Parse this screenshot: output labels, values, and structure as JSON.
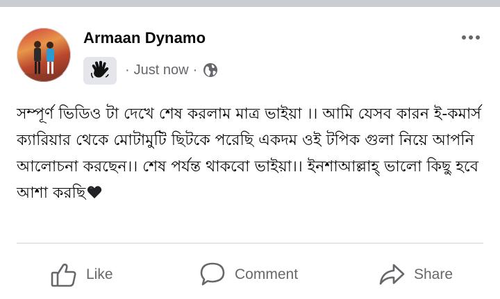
{
  "post": {
    "author_name": "Armaan Dynamo",
    "timestamp": "Just now",
    "separator": "·",
    "privacy_icon": "globe-icon",
    "badge_icon": "waving-hand-icon",
    "text": "সম্পূর্ণ ভিডিও টা দেখে শেষ করলাম মাত্র ভাইয়া ।। আমি যেসব কারন  ই-কমার্স ক্যারিয়ার থেকে মোটামুটি ছিটকে পরেছি একদম ওই টপিক গুলা নিয়ে আপনি আলোচনা করছেন।।  শেষ পর্যন্ত থাকবো ভাইয়া।। ইনশাআল্লাহ্ ভালো কিছু হবে আশা করছি",
    "emoji": "black-heart-icon"
  },
  "actions": {
    "like_label": "Like",
    "comment_label": "Comment",
    "share_label": "Share"
  },
  "colors": {
    "text_primary": "#050505",
    "text_secondary": "#65676b",
    "divider": "#ced0d4",
    "badge_bg": "#e4e6eb",
    "top_bar": "#c9ccd1"
  }
}
